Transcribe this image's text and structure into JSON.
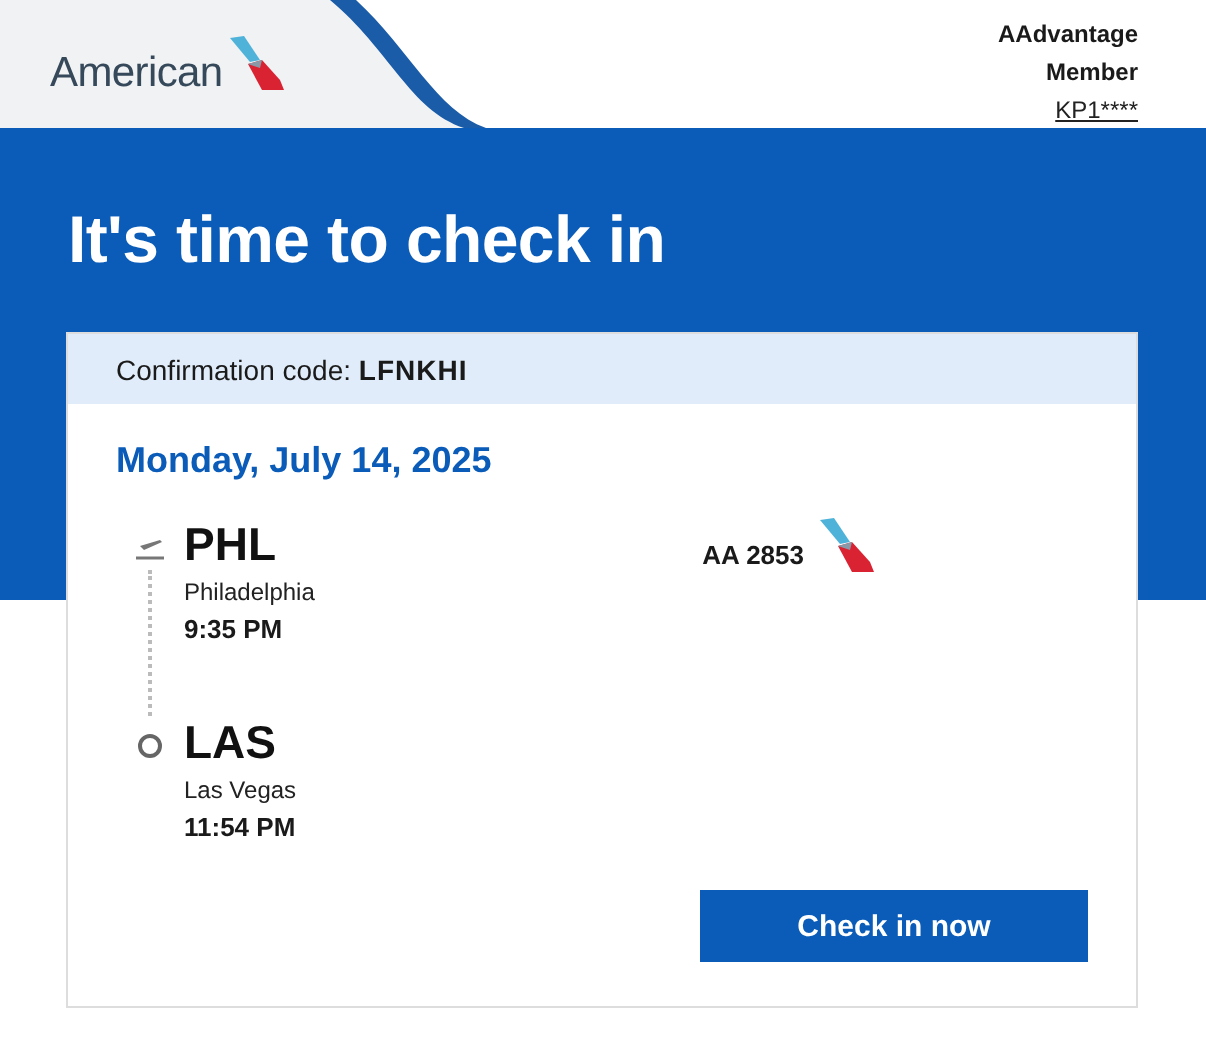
{
  "header": {
    "brand": "American",
    "member_lines": [
      "AAdvantage",
      "Member"
    ],
    "member_id": "KP1****"
  },
  "hero": {
    "title": "It's time to check in"
  },
  "card": {
    "confirmation_label": "Confirmation code:",
    "confirmation_code": "LFNKHI",
    "date": "Monday, July 14, 2025",
    "flight_number": "AA 2853",
    "stops": [
      {
        "kind": "departure",
        "code": "PHL",
        "city": "Philadelphia",
        "time": "9:35 PM"
      },
      {
        "kind": "arrival",
        "code": "LAS",
        "city": "Las Vegas",
        "time": "11:54 PM"
      }
    ],
    "button": "Check in now"
  }
}
